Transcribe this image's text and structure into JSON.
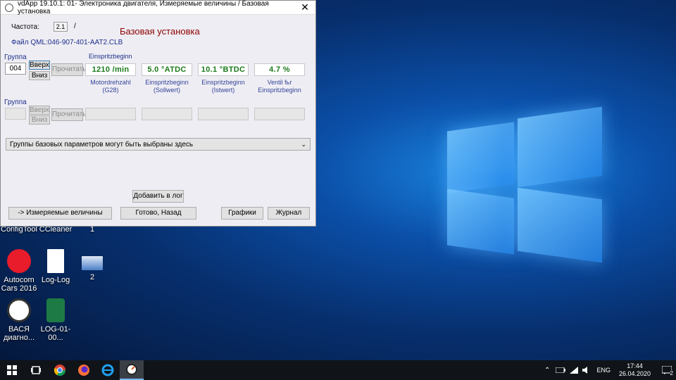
{
  "window": {
    "title": "vdApp 19.10.1: 01- Электроника двигателя,  Измеряемые величины / Базовая установка",
    "close_glyph": "✕",
    "heading": "Базовая установка",
    "frequency_label": "Частота:",
    "frequency_value": "2.1",
    "frequency_sep": "/",
    "file_label": "Файл QML:046-907-401-AAT2.CLB",
    "group1": {
      "label": "Группа",
      "value": "004",
      "up": "Вверх",
      "down": "Вниз",
      "read": "Прочитать",
      "column_header": "Einspritzbeginn",
      "values": [
        "1210 /min",
        "5.0 °ATDC",
        "10.1 °BTDC",
        "4.7 %"
      ],
      "captions": [
        "Motordrehzahl\n(G28)",
        "Einspritzbeginn\n(Sollwert)",
        "Einspritzbeginn\n(Istwert)",
        "Ventil fьr\nEinspritzbeginn"
      ]
    },
    "group2": {
      "label": "Группа",
      "up": "Вверх",
      "down": "Вниз",
      "read": "Прочитать"
    },
    "dropdown": "Группы базовых параметров могут быть выбраны здесь",
    "add_log": "Добавить в лог",
    "measured": "-> Измеряемые величины",
    "ready_back": "Готово, Назад",
    "graphs": "Графики",
    "journal": "Журнал"
  },
  "desktop": {
    "partial_labels": [
      "ConfigTool",
      "CCleaner",
      "1"
    ],
    "icons": [
      {
        "label": "Autocom\nCars 2016",
        "icon": "car-app-icon"
      },
      {
        "label": "Log-Log",
        "icon": "text-file-icon"
      },
      {
        "label": "2",
        "icon": "image-file-icon"
      },
      {
        "label": "ВАСЯ\nдиагно...",
        "icon": "vasya-app-icon"
      },
      {
        "label": "LOG-01-00...",
        "icon": "excel-file-icon"
      }
    ]
  },
  "taskbar": {
    "lang": "ENG",
    "time": "17:44",
    "date": "26.04.2020",
    "notifications": "2"
  },
  "colors": {
    "heading": "#8b0000",
    "value_text": "#1a7a1a",
    "label_blue": "#1c2e8c",
    "taskbar": "#101418"
  }
}
